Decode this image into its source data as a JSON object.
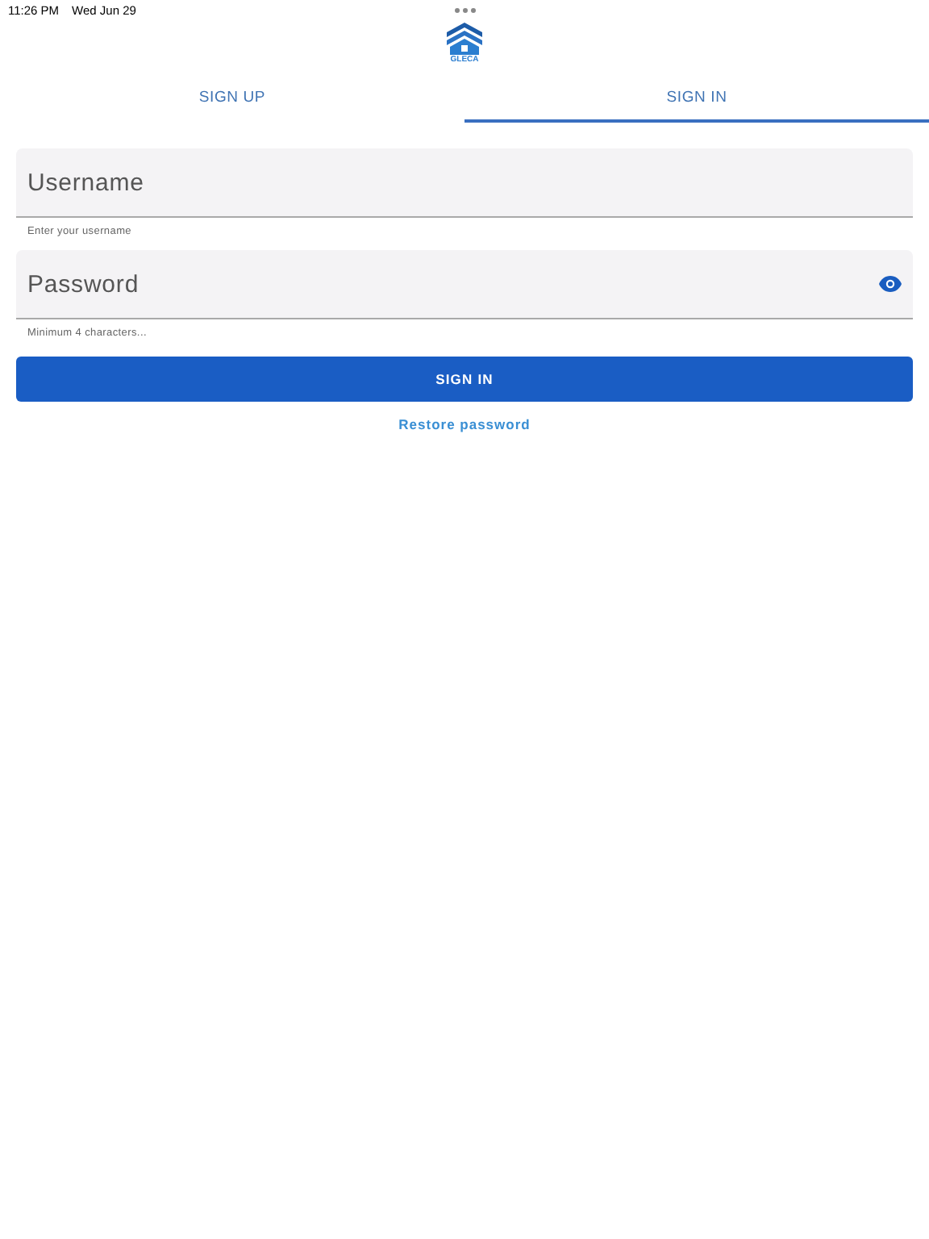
{
  "status_bar": {
    "time": "11:26 PM",
    "date": "Wed Jun 29"
  },
  "logo": {
    "text": "GLECA"
  },
  "tabs": [
    {
      "label": "SIGN UP",
      "selected": false
    },
    {
      "label": "SIGN IN",
      "selected": true
    }
  ],
  "fields": [
    {
      "placeholder": "Username",
      "helper": "Enter your username",
      "kind": "text"
    },
    {
      "placeholder": "Password",
      "helper": "Minimum 4 characters...",
      "kind": "password"
    }
  ],
  "submit_button": "SIGN IN",
  "restore_link": "Restore password"
}
